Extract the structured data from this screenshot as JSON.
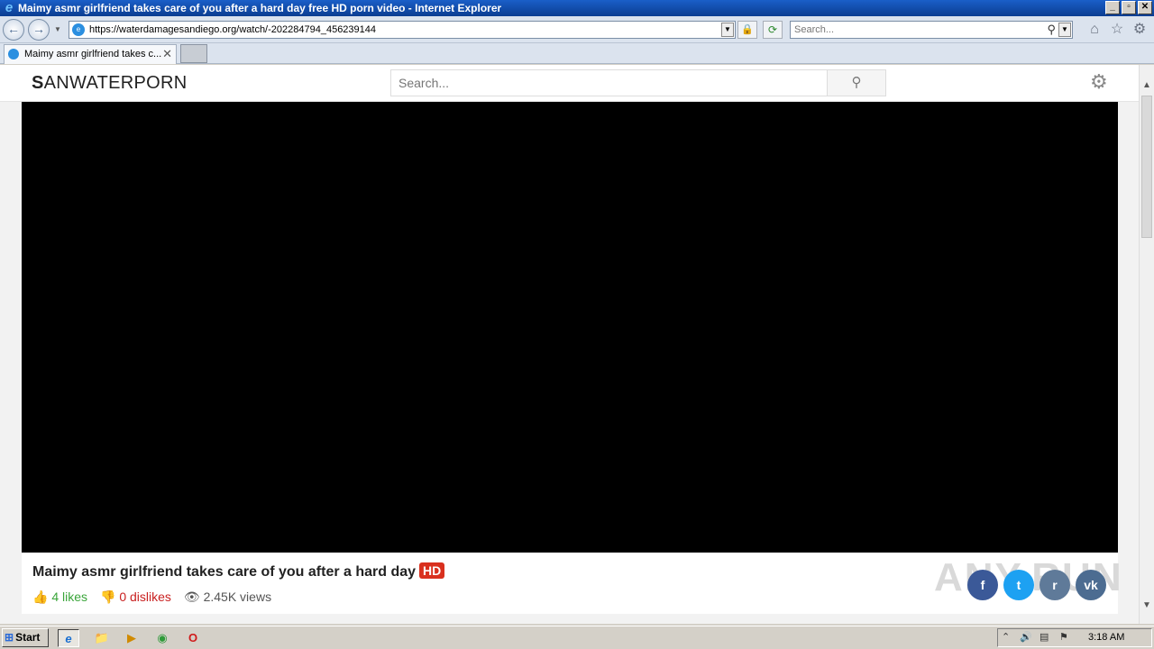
{
  "window": {
    "title": "Maimy asmr girlfriend takes care of you after a hard day free HD porn video - Internet Explorer",
    "minimize": "_",
    "restore": "▫",
    "close": "✕"
  },
  "nav": {
    "back": "←",
    "forward": "→",
    "history_dropdown": "▼",
    "url": "https://waterdamagesandiego.org/watch/-202284794_456239144",
    "url_dropdown": "▼",
    "lock": "🔒",
    "refresh": "⟳",
    "search_placeholder": "Search...",
    "search_glyph": "⚲",
    "search_dropdown": "▼",
    "home": "⌂",
    "favorites": "☆",
    "tools": "⚙"
  },
  "tabs": [
    {
      "label": "Maimy asmr girlfriend takes c...",
      "close": "✕"
    }
  ],
  "site": {
    "logo_first": "S",
    "logo_rest": "ANWATERPORN",
    "search_placeholder": "Search...",
    "search_button": "⚲",
    "settings": "⚙"
  },
  "video": {
    "title": "Maimy asmr girlfriend takes care of you after a hard day",
    "badge": "HD",
    "likes": "👍 4 likes",
    "dislikes": "👎 0 dislikes",
    "views": "👁 2.45K views"
  },
  "share": {
    "facebook": "f",
    "twitter": "t",
    "reddit": "r",
    "vk": "vk"
  },
  "watermark": "ANY.RUN",
  "scrollbar": {
    "up": "▲",
    "down": "▼"
  },
  "taskbar": {
    "start": "Start",
    "start_flag": "⊞",
    "quick_launch": [
      "e",
      "📁",
      "▶",
      "◉",
      "O"
    ],
    "tray_icons": [
      "⌃",
      "🔊",
      "▤",
      "⚑"
    ],
    "clock": "3:18 AM"
  },
  "colors": {
    "title_bar": "#0b3d91",
    "likes": "#3aa53a",
    "dislikes": "#c92020",
    "hd_badge": "#d9301e",
    "facebook": "#3b5998",
    "twitter": "#1da1f2"
  }
}
